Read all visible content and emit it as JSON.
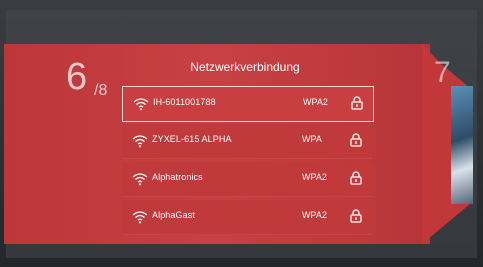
{
  "pager": {
    "current": "6",
    "total": "/8",
    "next": "7"
  },
  "screen_title": "Netzwerkverbindung",
  "networks": [
    {
      "ssid": "IH-6011001788",
      "security": "WPA2",
      "selected": true
    },
    {
      "ssid": "ZYXEL-615 ALPHA",
      "security": "WPA",
      "selected": false
    },
    {
      "ssid": "Alphatronics",
      "security": "WPA2",
      "selected": false
    },
    {
      "ssid": "AlphaGast",
      "security": "WPA2",
      "selected": false
    }
  ],
  "icons": {
    "signal": "wifi-icon",
    "security": "lock-icon"
  },
  "colors": {
    "panel": "#c63a3d",
    "text": "#ffffff"
  }
}
